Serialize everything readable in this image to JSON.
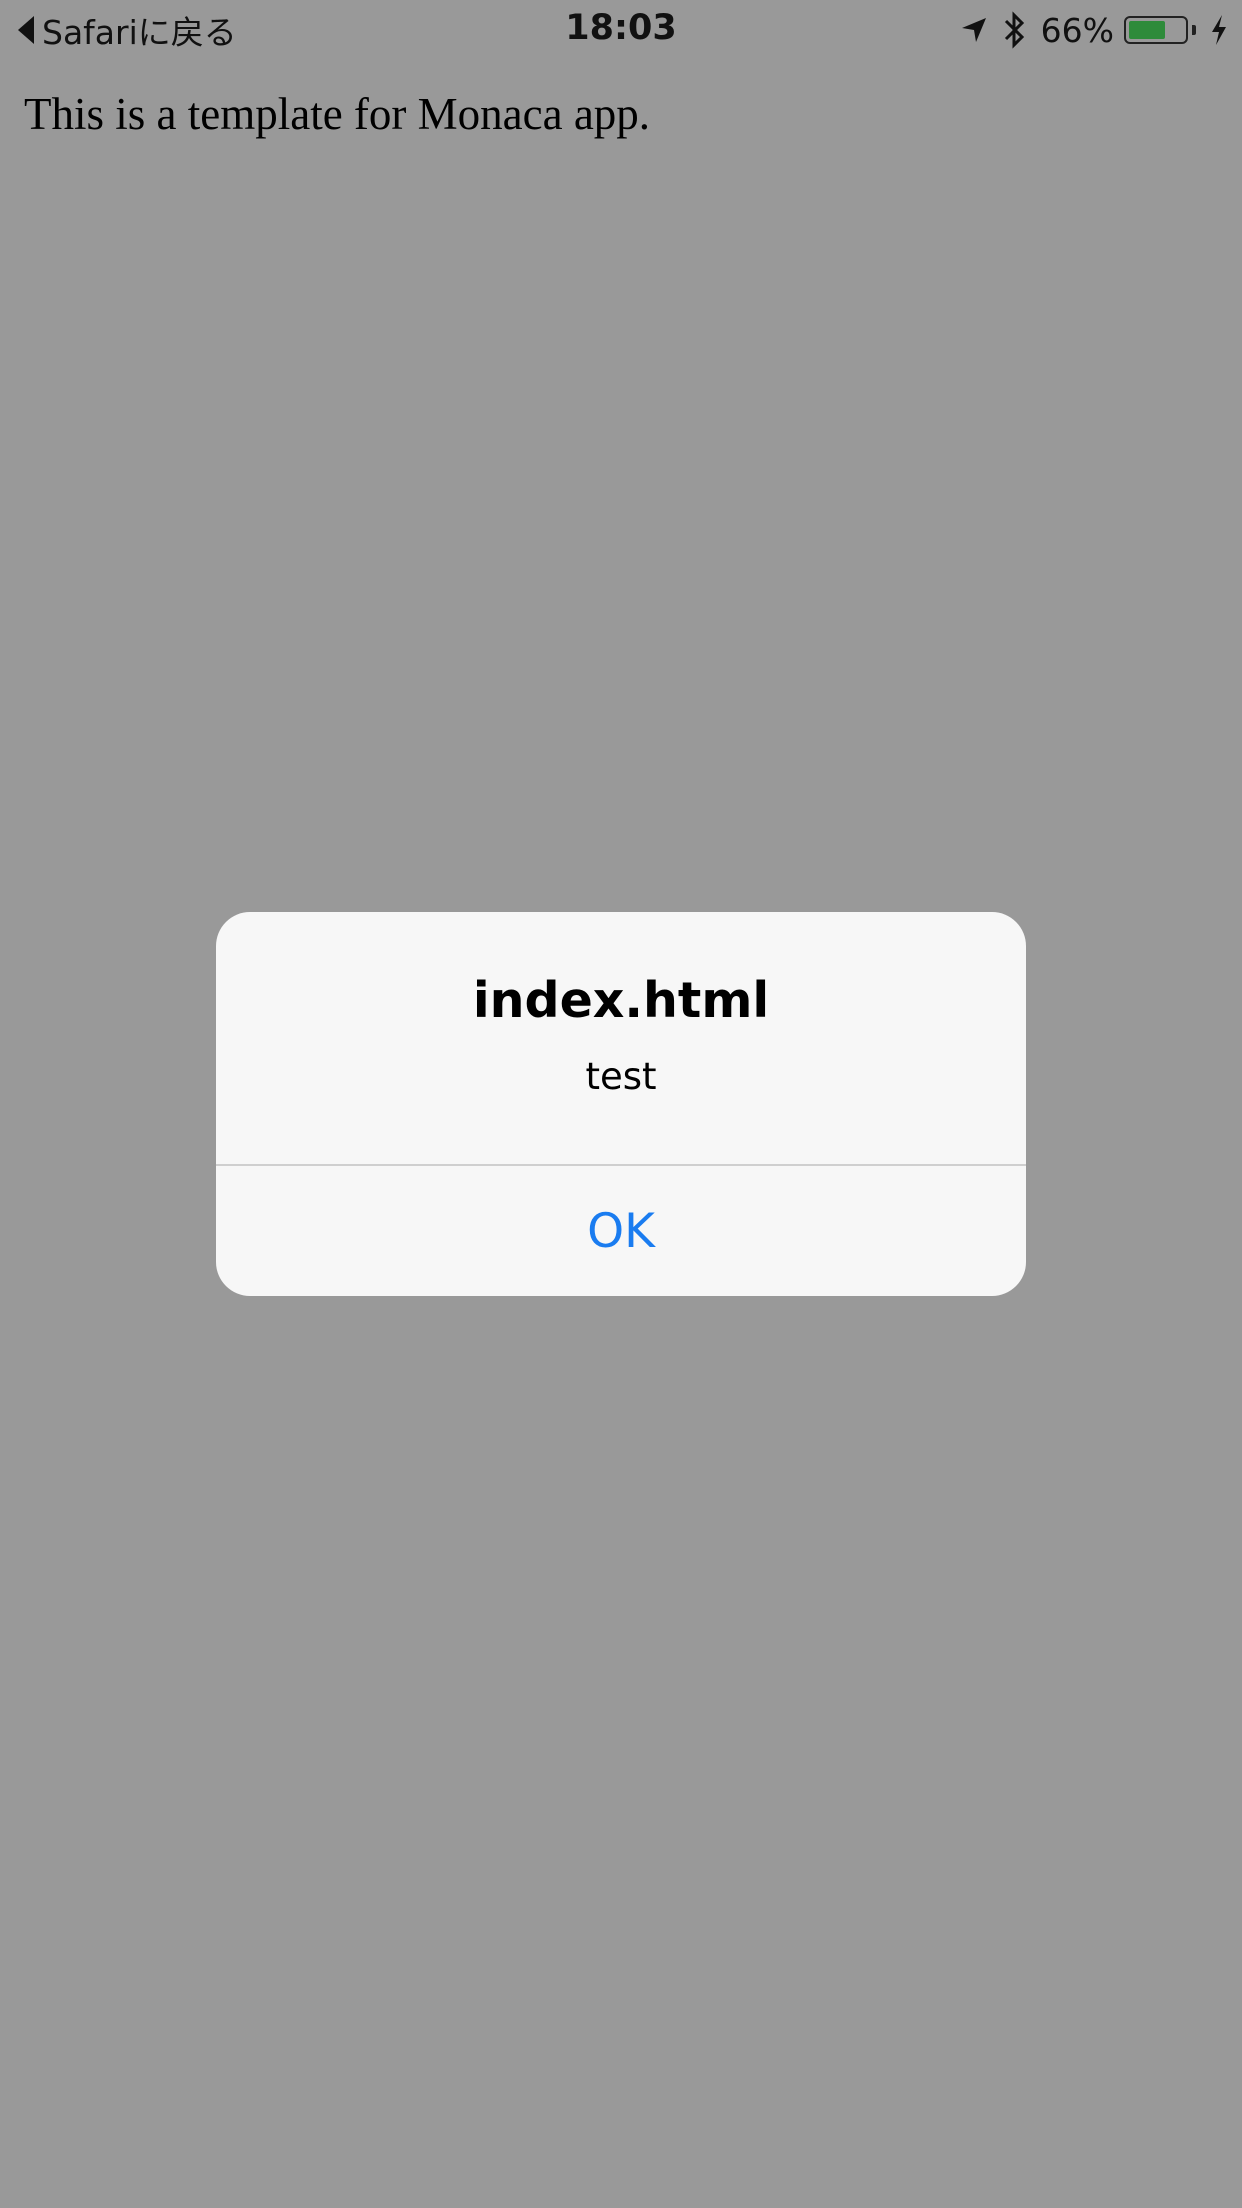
{
  "status_bar": {
    "back_label": "Safariに戻る",
    "time": "18:03",
    "battery_percent_text": "66%",
    "battery_level": 0.66,
    "icons": [
      "location-arrow-icon",
      "bluetooth-icon",
      "battery-icon",
      "charging-bolt-icon"
    ],
    "battery_color": "#2e8b3a"
  },
  "page": {
    "text": "This is a template for Monaca app.",
    "background_color": "#999999"
  },
  "alert": {
    "title": "index.html",
    "message": "test",
    "ok_label": "OK",
    "button_color": "#1a7cf0"
  }
}
